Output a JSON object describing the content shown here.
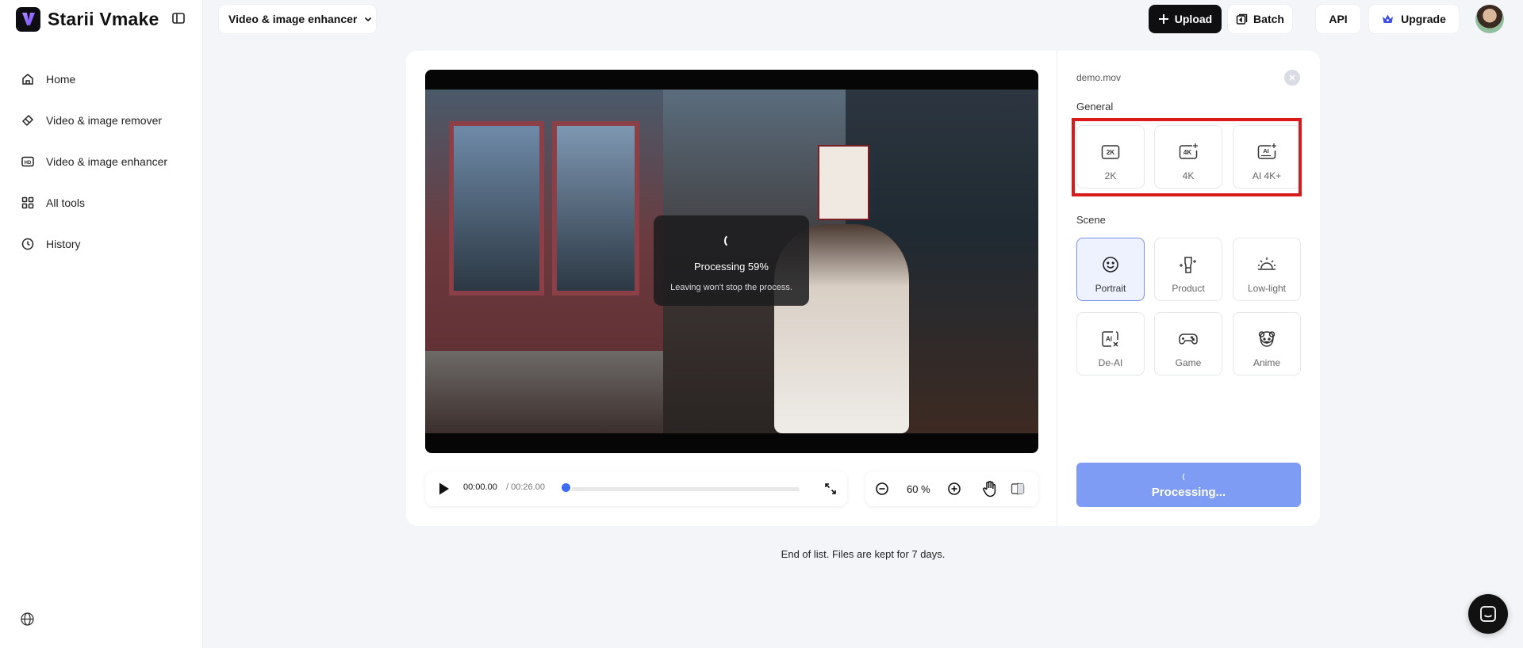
{
  "brand": {
    "name": "Starii Vmake",
    "logo_letter": "V"
  },
  "sidebar": {
    "items": [
      {
        "label": "Home",
        "icon": "home-icon"
      },
      {
        "label": "Video & image remover",
        "icon": "eraser-icon"
      },
      {
        "label": "Video & image enhancer",
        "icon": "hd-icon"
      },
      {
        "label": "All tools",
        "icon": "grid-icon"
      },
      {
        "label": "History",
        "icon": "clock-icon"
      }
    ]
  },
  "topbar": {
    "mode": "Video & image enhancer",
    "upload": "Upload",
    "batch": "Batch",
    "api": "API",
    "upgrade": "Upgrade"
  },
  "video": {
    "overlay_title": "Processing 59%",
    "overlay_sub": "Leaving won't stop the process.",
    "progress_percent": 59
  },
  "player": {
    "current_time": "00:00.00",
    "total_time": "/ 00:26.00",
    "playback_fraction": 0.0,
    "zoom": "60 %"
  },
  "panel": {
    "file_name": "demo.mov",
    "general_label": "General",
    "general_options": [
      "2K",
      "4K",
      "AI 4K+"
    ],
    "scene_label": "Scene",
    "scene_options": [
      "Portrait",
      "Product",
      "Low-light",
      "De-AI",
      "Game",
      "Anime"
    ],
    "selected_scene": "Portrait",
    "processing_label": "Processing..."
  },
  "footer": {
    "end_text": "End of list. Files are kept for 7 days."
  },
  "colors": {
    "accent": "#3d6cf0",
    "processing_button": "#7f9cf5",
    "highlight_box": "#d81a1a",
    "selected_bg": "#eef2ff"
  }
}
